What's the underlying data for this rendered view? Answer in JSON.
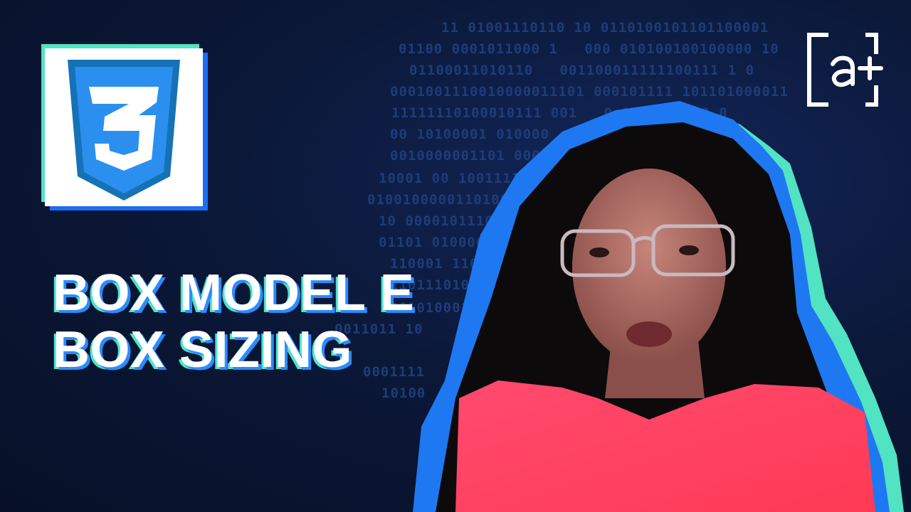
{
  "background": {
    "binary_lines": [
      "11 01001110110 10 0110100101101100001",
      "01100 0001011000 1   000 010100100100000 10",
      "01100011010110   001100011111100111 1 0",
      "0001001110010000011101 000101111 101101000011",
      "11111110100010111 001   0 00000011 0 0",
      "00 10100001 010000           001011",
      "0010000001101 00010           1001 10 0",
      "10001 00 1001111            1101",
      "01001000001101000          0100011 00",
      "10 0000101110001         0  1  0",
      "01101 01000000          1",
      "110001 110001           1",
      "11011101011              11 100",
      "00101000101",
      "0011011 10",
      "0001111",
      "10100"
    ]
  },
  "logo": {
    "name": "css3-logo",
    "number": "3"
  },
  "title": {
    "line1": "BOX MODEL E",
    "line2": "BOX SIZING"
  },
  "brand": {
    "name": "alura-plus-logo",
    "glyph": "a+"
  },
  "colors": {
    "background": "#0a1530",
    "accent_blue": "#2a8cff",
    "accent_green": "#52e3c2",
    "css_blue": "#2b8ff0",
    "text": "#ffffff"
  }
}
